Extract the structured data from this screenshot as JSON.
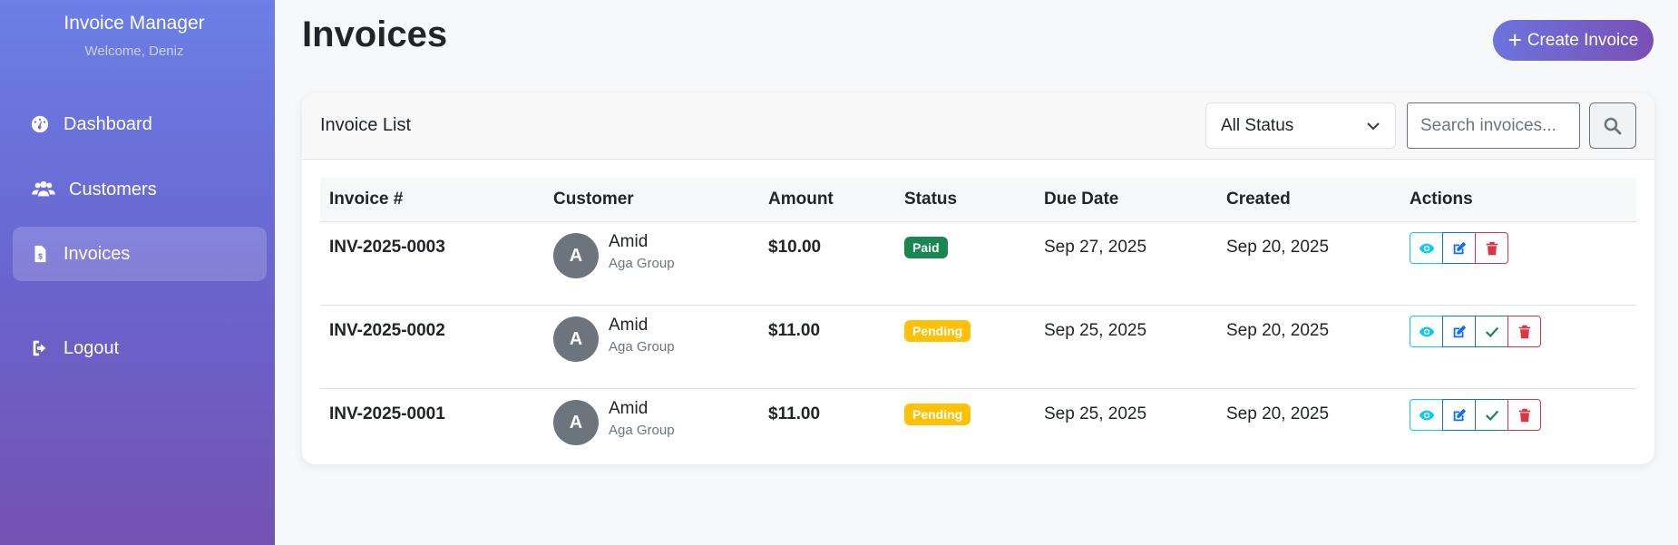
{
  "sidebar": {
    "brand": "Invoice Manager",
    "welcome": "Welcome, Deniz",
    "items": [
      {
        "label": "Dashboard",
        "icon": "dashboard-icon"
      },
      {
        "label": "Customers",
        "icon": "users-icon"
      },
      {
        "label": "Invoices",
        "icon": "invoice-file-icon",
        "active": true
      },
      {
        "label": "Logout",
        "icon": "logout-icon"
      }
    ]
  },
  "header": {
    "title": "Invoices",
    "create_label": "Create Invoice"
  },
  "card": {
    "title": "Invoice List",
    "status_filter": "All Status",
    "search_placeholder": "Search invoices..."
  },
  "table": {
    "columns": [
      "Invoice #",
      "Customer",
      "Amount",
      "Status",
      "Due Date",
      "Created",
      "Actions"
    ],
    "rows": [
      {
        "invoice": "INV-2025-0003",
        "initial": "A",
        "customer": "Amid",
        "company": "Aga Group",
        "amount": "$10.00",
        "status": "Paid",
        "due": "Sep 27, 2025",
        "created": "Sep 20, 2025"
      },
      {
        "invoice": "INV-2025-0002",
        "initial": "A",
        "customer": "Amid",
        "company": "Aga Group",
        "amount": "$11.00",
        "status": "Pending",
        "due": "Sep 25, 2025",
        "created": "Sep 20, 2025"
      },
      {
        "invoice": "INV-2025-0001",
        "initial": "A",
        "customer": "Amid",
        "company": "Aga Group",
        "amount": "$11.00",
        "status": "Pending",
        "due": "Sep 25, 2025",
        "created": "Sep 20, 2025"
      }
    ]
  },
  "colors": {
    "sidebar_gradient_top": "#6b7fe6",
    "sidebar_gradient_bottom": "#7452b2",
    "paid": "#198754",
    "pending": "#ffc107",
    "view": "#0dcaf0",
    "edit": "#0d6efd",
    "delete": "#dc3545"
  }
}
